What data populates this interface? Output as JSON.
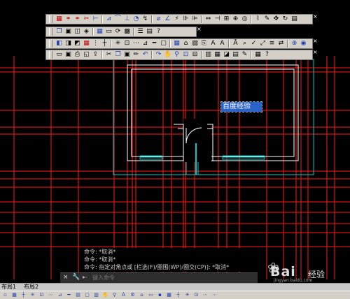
{
  "toolbars": {
    "row1": [
      "grid-red-icon",
      "link-icon",
      "link-icon",
      "scissors-icon",
      "linear-dim-icon",
      "aligned-dim-icon",
      "arc-dim-icon",
      "ordinate-dim-icon",
      "radius-dim-icon",
      "jogged-dim-icon",
      "diameter-dim-icon",
      "angular-dim-icon",
      "quick-dim-icon",
      "baseline-dim-icon",
      "continue-dim-icon",
      "spacing-icon",
      "break-icon",
      "tolerance-icon",
      "center-mark-icon",
      "inspect-icon",
      "jog-line-icon",
      "edit-dim-icon",
      "move-icon",
      "rotate-icon",
      "style-icon"
    ],
    "row2": [
      "copy-icon",
      "paste-icon",
      "paste-special-icon",
      "paint-icon",
      "table-icon",
      "field-icon",
      "update-icon",
      "block-icon",
      "list-icon",
      "properties-icon",
      "help-icon"
    ],
    "row3": [
      "layer-icon",
      "layer-state-icon",
      "layer-prev-icon",
      "grid-red-icon",
      "snap-icon",
      "ortho-icon",
      "polar-icon",
      "osnap-icon",
      "otrack-icon",
      "dyn-icon",
      "lwt-icon",
      "model-icon",
      "table-icon",
      "xref-icon",
      "image-icon",
      "attach-icon",
      "text-icon",
      "mtext-icon",
      "edit-text-icon",
      "find-icon",
      "spell-icon",
      "scale-icon",
      "justify-icon",
      "convert-icon",
      "globe-icon",
      "earth-icon"
    ],
    "row4": [
      "open-icon",
      "save-icon",
      "plot-icon",
      "preview-icon",
      "publish-icon",
      "cut-icon",
      "copy-icon",
      "paste-icon",
      "match-icon",
      "undo-icon",
      "redo-icon",
      "pan-icon",
      "zoom-icon",
      "zoom-window-icon",
      "zoom-prev-icon",
      "props-icon",
      "design-icon",
      "palette-icon",
      "sheet-icon",
      "markup-icon",
      "calc-icon",
      "help-icon"
    ],
    "close_glyph": "×"
  },
  "mtext_editor": {
    "text": "百度经验"
  },
  "command": {
    "history": [
      "命令: *取消*",
      "命令: *取消*",
      "命令: 指定对角点或 [栏选(F)/圈围(WP)/圈交(CP)]: *取消*"
    ],
    "close_glyph": "×",
    "wrench_glyph": "🔧",
    "prompt_glyph": "▸-",
    "placeholder": "键入命令"
  },
  "tabs": [
    "布局1",
    "布局2"
  ],
  "watermark": {
    "paw": "❀",
    "brand": "Bai",
    "suffix": "经验",
    "url": "jingyan.baidu.com"
  },
  "colors": {
    "background": "#000000",
    "grid_lines": "#ff1a1a",
    "construction": "#00c8c8",
    "walls": "#ffffff",
    "selection": "#2b62c8"
  }
}
